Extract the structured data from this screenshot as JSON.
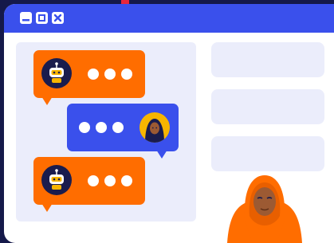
{
  "window": {
    "controls": [
      {
        "name": "minimize",
        "icon": "minimize-icon"
      },
      {
        "name": "restore",
        "icon": "restore-icon"
      },
      {
        "name": "close",
        "icon": "close-icon"
      }
    ]
  },
  "chat": {
    "messages": [
      {
        "sender": "bot",
        "color": "#ff6d00",
        "avatar_icon": "robot-icon",
        "typing_dots": 3
      },
      {
        "sender": "user",
        "color": "#3a50ec",
        "avatar_icon": "hijab-woman-avatar",
        "typing_dots": 3
      },
      {
        "sender": "bot",
        "color": "#ff6d00",
        "avatar_icon": "robot-icon",
        "typing_dots": 3
      }
    ]
  },
  "side_panel": {
    "placeholder_cards": 3
  },
  "colors": {
    "background": "#15194a",
    "titlebar": "#3a50ec",
    "bot_bubble": "#ff6d00",
    "user_bubble": "#3a50ec",
    "chat_area": "#ebedfb",
    "hijab": "#ff6d00"
  }
}
